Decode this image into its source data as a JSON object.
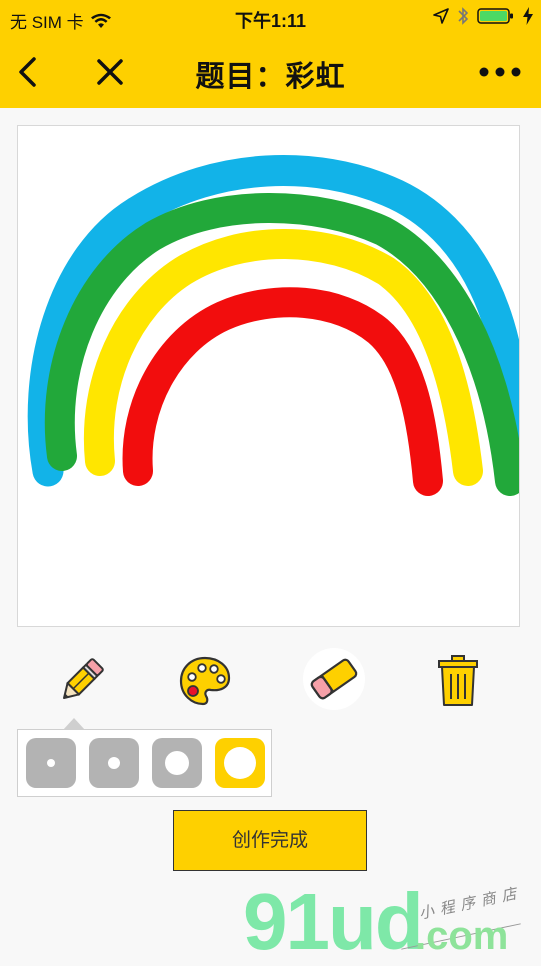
{
  "status": {
    "carrier": "无 SIM 卡",
    "time": "下午1:11"
  },
  "nav": {
    "title": "题目：彩虹"
  },
  "canvas": {
    "strokes": [
      {
        "color": "#12b3e8",
        "name": "blue-stroke"
      },
      {
        "color": "#22a83a",
        "name": "green-stroke"
      },
      {
        "color": "#ffe600",
        "name": "yellow-stroke"
      },
      {
        "color": "#f20d0d",
        "name": "red-stroke"
      }
    ]
  },
  "tools": [
    "pencil-icon",
    "palette-icon",
    "eraser-icon",
    "trash-icon"
  ],
  "pen_sizes": {
    "options": [
      "small",
      "medium",
      "large",
      "extra-large"
    ],
    "selected": "extra-large"
  },
  "actions": {
    "finish_label": "创作完成"
  },
  "watermark": {
    "brand": "91ud",
    "domain": ".com",
    "tagline": "小程序商店"
  },
  "colors": {
    "accent": "#fed000",
    "size_inactive": "#b3b3b3"
  }
}
